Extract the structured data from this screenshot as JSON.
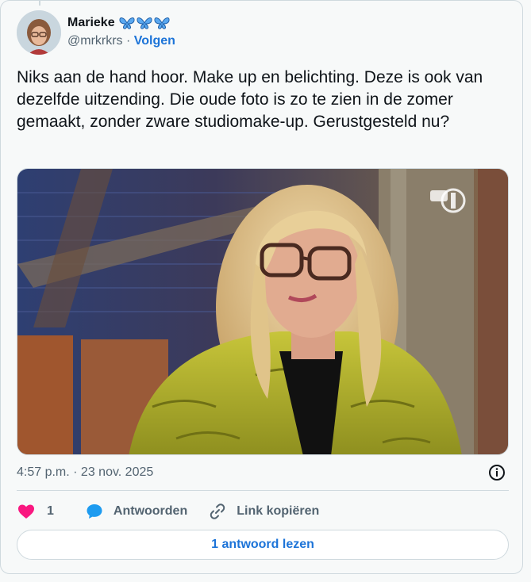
{
  "user": {
    "name": "Marieke",
    "handle": "@mrkrkrs",
    "separator": "·",
    "follow_label": "Volgen",
    "badge_icons": [
      "butterfly-icon",
      "butterfly-icon",
      "butterfly-icon"
    ]
  },
  "tweet": {
    "text": "Niks aan de hand hoor. Make up en belichting. Deze is ook van dezelfde uitzending. Die oude foto is zo te zien in de zomer gemaakt, zonder zware studiomake-up. Gerustgesteld nu?",
    "timestamp": "4:57 p.m. · 23 nov. 2025"
  },
  "media": {
    "channel_logo": "NPO 1"
  },
  "actions": {
    "like_count": "1",
    "reply_label": "Antwoorden",
    "copy_link_label": "Link kopiëren"
  },
  "footer": {
    "read_replies_label": "1 antwoord lezen"
  },
  "colors": {
    "accent": "#1d74d8",
    "like": "#f91880",
    "text": "#0f1419",
    "muted": "#536471",
    "border": "#cfd9de"
  }
}
